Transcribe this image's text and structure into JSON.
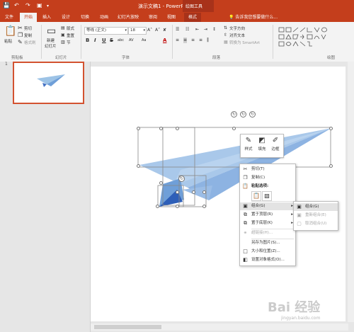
{
  "app": {
    "doc_title": "演示文稿1 - PowerPoint",
    "context_tools_label": "绘图工具",
    "accent": "#c43e1c"
  },
  "quick_access": {
    "icons": [
      "save-icon",
      "undo-icon",
      "redo-icon",
      "start-from-beginning-icon",
      "customize-qat-icon"
    ]
  },
  "tabs": {
    "file": "文件",
    "home": "开始",
    "insert": "插入",
    "design": "设计",
    "transitions": "切换",
    "animations": "动画",
    "slideshow": "幻灯片放映",
    "review": "审阅",
    "view": "视图",
    "format": "格式",
    "tell_me": "告诉我您想要做什么..."
  },
  "ribbon": {
    "clipboard": {
      "paste": "粘贴",
      "cut": "剪切",
      "copy": "复制",
      "format_painter": "格式刷",
      "label": "剪贴板"
    },
    "slides": {
      "new_slide": "新建",
      "new_slide_2": "幻灯片",
      "layout": "版式",
      "reset": "重置",
      "section": "节",
      "label": "幻灯片"
    },
    "font": {
      "font_name": "等线 (正文)",
      "font_size": "18",
      "label": "字体",
      "bold": "B",
      "italic": "I",
      "underline": "U",
      "strike": "S",
      "shadow": "abc",
      "spacing": "AV",
      "case": "Aa",
      "color": "A"
    },
    "paragraph": {
      "text_direction": "文字方向",
      "align_text": "对齐文本",
      "smartart": "转换为 SmartArt",
      "label": "段落"
    },
    "drawing": {
      "label": "绘图"
    }
  },
  "slides_panel": {
    "slide_number": "1"
  },
  "mini_toolbar": {
    "style": "样式",
    "fill": "填充",
    "outline": "边框"
  },
  "context_menu": {
    "cut": "剪切(T)",
    "copy": "复制(C)",
    "paste_options": "粘贴选项:",
    "group": "组合(G)",
    "bring_to_front": "置于顶层(R)",
    "send_to_back": "置于底层(K)",
    "hyperlink": "超链接(H)...",
    "save_as_picture": "另存为图片(S)...",
    "size_position": "大小和位置(Z)...",
    "format_object": "设置对象格式(O)..."
  },
  "submenu": {
    "group": "组合(G)",
    "regroup": "重新组合(E)",
    "ungroup": "取消组合(U)"
  },
  "watermark": {
    "text": "Bai 经验",
    "sub": "jingyan.baidu.com"
  }
}
